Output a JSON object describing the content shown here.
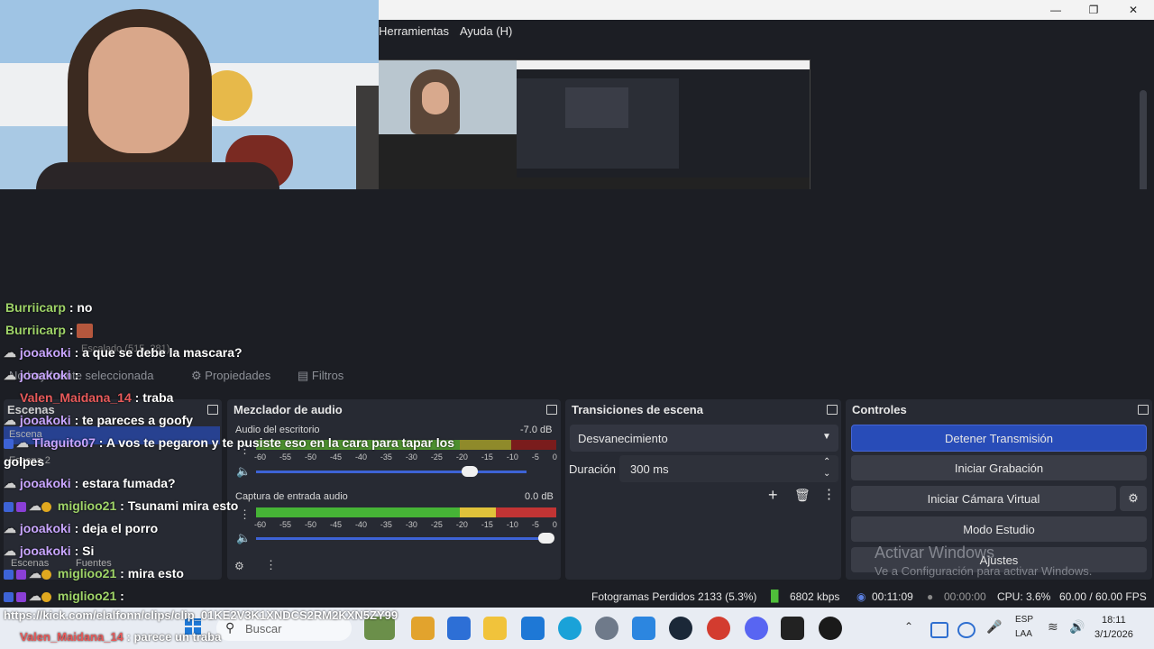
{
  "menubar": {
    "items": [
      "Herramientas",
      "Ayuda (H)"
    ]
  },
  "toolbar": {
    "scene_label": "Escena 2",
    "escalado": "Escalado (515, 281)",
    "propiedades": "Propiedades",
    "filtros": "Filtros",
    "nothing_selected": "No hay fuente seleccionada"
  },
  "scenes_panel": {
    "title": "Escenas",
    "items": [
      "Escena",
      "Escena 2"
    ],
    "tabs": [
      "Escenas",
      "Fuentes"
    ]
  },
  "audio_mixer": {
    "title": "Mezclador de audio",
    "channels": [
      {
        "name": "Audio del escritorio",
        "db": "-7.0 dB",
        "level": 0.94
      },
      {
        "name": "Captura de entrada audio",
        "db": "0.0 dB",
        "level": 0.98
      }
    ],
    "scale": [
      "-60",
      "-55",
      "-50",
      "-45",
      "-40",
      "-35",
      "-30",
      "-25",
      "-20",
      "-15",
      "-10",
      "-5",
      "0"
    ]
  },
  "transitions": {
    "title": "Transiciones de escena",
    "selected": "Desvanecimiento",
    "duration_label": "Duración",
    "duration_value": "300 ms"
  },
  "controls": {
    "title": "Controles",
    "buttons": [
      "Detener Transmisión",
      "Iniciar Grabación",
      "Iniciar Cámara Virtual",
      "Modo Estudio",
      "Ajustes"
    ]
  },
  "watermark": {
    "line1": "Activar Windows",
    "line2": "Ve a Configuración para activar Windows."
  },
  "statusbar": {
    "frames_dropped": "Fotogramas Perdidos 2133 (5.3%)",
    "bitrate": "6802 kbps",
    "stream_time": "00:11:09",
    "rec_time": "00:00:00",
    "cpu": "CPU: 3.6%",
    "fps": "60.00 / 60.00 FPS"
  },
  "chat": [
    {
      "user": "Burriicarp",
      "text": ": no",
      "style": "user"
    },
    {
      "user": "Burriicarp",
      "text": ":",
      "style": "user"
    },
    {
      "user": "jooakoki",
      "text": ": a que se debe la mascara?",
      "style": "user2"
    },
    {
      "user": "jooakoki",
      "text": ":",
      "style": "user2"
    },
    {
      "user": "Valen_Maidana_14",
      "text": ": traba",
      "style": "user3"
    },
    {
      "user": "jooakoki",
      "text": ": te pareces a goofy",
      "style": "user2"
    },
    {
      "user": "Tlaguito07",
      "text": ": A vos te pegaron y te pusiste eso en la cara para tapar los",
      "style": "user2"
    },
    {
      "user": "",
      "text": "golpes",
      "style": "user"
    },
    {
      "user": "jooakoki",
      "text": ": estara fumada?",
      "style": "user2"
    },
    {
      "user": "miglioo21",
      "text": ": Tsunami mira esto",
      "style": "user"
    },
    {
      "user": "jooakoki",
      "text": ": deja el porro",
      "style": "user2"
    },
    {
      "user": "jooakoki",
      "text": ": Si",
      "style": "user2"
    },
    {
      "user": "miglioo21",
      "text": ": mira esto",
      "style": "user"
    },
    {
      "user": "miglioo21",
      "text": ":",
      "style": "user"
    },
    {
      "user": "",
      "text": "https://kick.com/elalfonn/clips/clip_01KE2V3K1XNDCS2RM2KXN5ZY99",
      "style": "user"
    },
    {
      "user": "Valen_Maidana_14",
      "text": ": parece un traba",
      "style": "user3"
    }
  ],
  "taskbar": {
    "search_placeholder": "Buscar",
    "lang": "ESP",
    "lang2": "LAA",
    "time": "18:11",
    "date": "3/1/2026"
  }
}
